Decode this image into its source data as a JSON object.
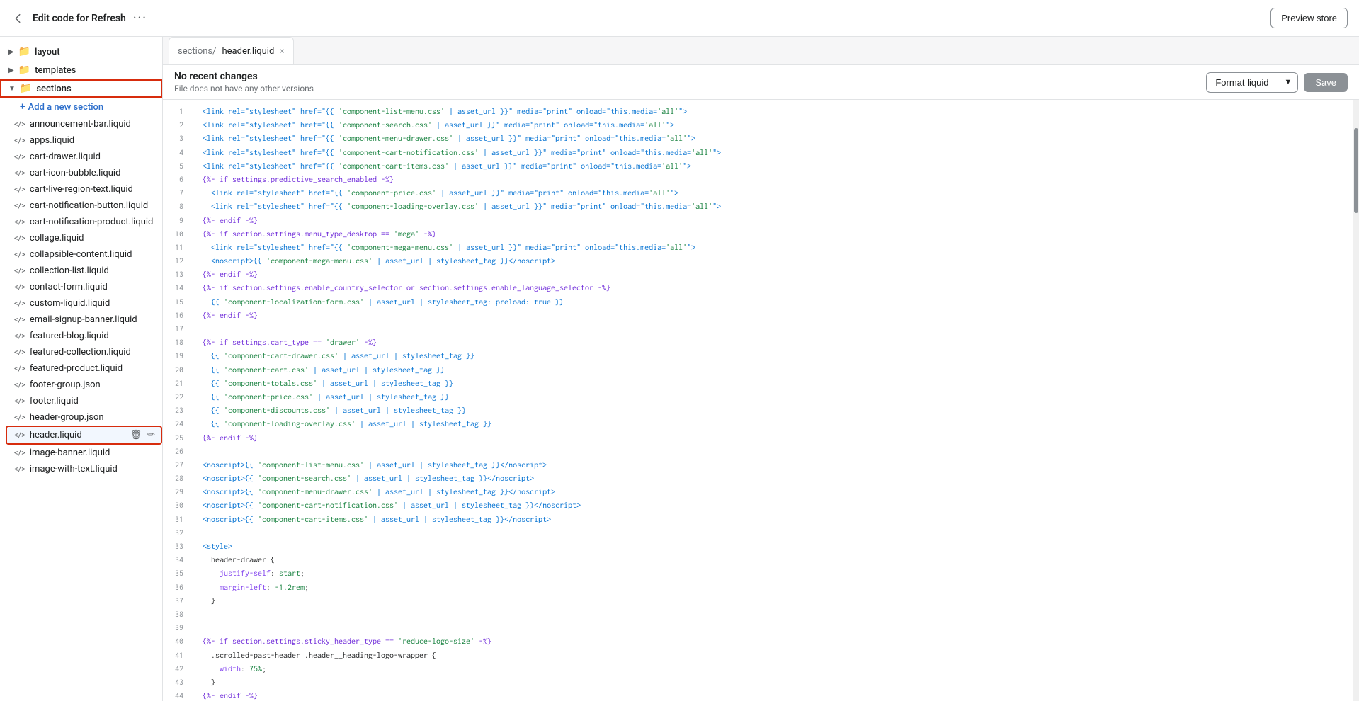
{
  "topbar": {
    "title": "Edit code for Refresh",
    "more_icon": "···",
    "preview_label": "Preview store",
    "back_icon": "←"
  },
  "sidebar": {
    "layout_label": "layout",
    "templates_label": "templates",
    "sections_label": "sections",
    "add_section_label": "Add a new section",
    "sections_files": [
      "announcement-bar.liquid",
      "apps.liquid",
      "cart-drawer.liquid",
      "cart-icon-bubble.liquid",
      "cart-live-region-text.liquid",
      "cart-notification-button.liquid",
      "cart-notification-product.liquid",
      "collage.liquid",
      "collapsible-content.liquid",
      "collection-list.liquid",
      "contact-form.liquid",
      "custom-liquid.liquid",
      "email-signup-banner.liquid",
      "featured-blog.liquid",
      "featured-collection.liquid",
      "featured-product.liquid",
      "footer-group.json",
      "footer.liquid",
      "header-group.json",
      "header.liquid",
      "image-banner.liquid",
      "image-with-text.liquid"
    ],
    "active_file": "header.liquid"
  },
  "tab": {
    "path": "sections/",
    "filename": "header.liquid",
    "close_icon": "×"
  },
  "status": {
    "title": "No recent changes",
    "subtitle": "File does not have any other versions"
  },
  "toolbar": {
    "format_label": "Format liquid",
    "save_label": "Save"
  },
  "code": {
    "lines": [
      {
        "num": 1,
        "content": "<link rel=\"stylesheet\" href=\"{{ 'component-list-menu.css' | asset_url }}\" media=\"print\" onload=\"this.media='all'\">"
      },
      {
        "num": 2,
        "content": "<link rel=\"stylesheet\" href=\"{{ 'component-search.css' | asset_url }}\" media=\"print\" onload=\"this.media='all'\">"
      },
      {
        "num": 3,
        "content": "<link rel=\"stylesheet\" href=\"{{ 'component-menu-drawer.css' | asset_url }}\" media=\"print\" onload=\"this.media='all'\">"
      },
      {
        "num": 4,
        "content": "<link rel=\"stylesheet\" href=\"{{ 'component-cart-notification.css' | asset_url }}\" media=\"print\" onload=\"this.media='all'\">"
      },
      {
        "num": 5,
        "content": "<link rel=\"stylesheet\" href=\"{{ 'component-cart-items.css' | asset_url }}\" media=\"print\" onload=\"this.media='all'\">"
      },
      {
        "num": 6,
        "content": "{%- if settings.predictive_search_enabled -%}"
      },
      {
        "num": 7,
        "content": "  <link rel=\"stylesheet\" href=\"{{ 'component-price.css' | asset_url }}\" media=\"print\" onload=\"this.media='all'\">"
      },
      {
        "num": 8,
        "content": "  <link rel=\"stylesheet\" href=\"{{ 'component-loading-overlay.css' | asset_url }}\" media=\"print\" onload=\"this.media='all'\">"
      },
      {
        "num": 9,
        "content": "{%- endif -%}"
      },
      {
        "num": 10,
        "content": "{%- if section.settings.menu_type_desktop == 'mega' -%}"
      },
      {
        "num": 11,
        "content": "  <link rel=\"stylesheet\" href=\"{{ 'component-mega-menu.css' | asset_url }}\" media=\"print\" onload=\"this.media='all'\">"
      },
      {
        "num": 12,
        "content": "  <noscript>{{ 'component-mega-menu.css' | asset_url | stylesheet_tag }}</noscript>"
      },
      {
        "num": 13,
        "content": "{%- endif -%}"
      },
      {
        "num": 14,
        "content": "{%- if section.settings.enable_country_selector or section.settings.enable_language_selector -%}"
      },
      {
        "num": 15,
        "content": "  {{ 'component-localization-form.css' | asset_url | stylesheet_tag: preload: true }}"
      },
      {
        "num": 16,
        "content": "{%- endif -%}"
      },
      {
        "num": 17,
        "content": ""
      },
      {
        "num": 18,
        "content": "{%- if settings.cart_type == 'drawer' -%}"
      },
      {
        "num": 19,
        "content": "  {{ 'component-cart-drawer.css' | asset_url | stylesheet_tag }}"
      },
      {
        "num": 20,
        "content": "  {{ 'component-cart.css' | asset_url | stylesheet_tag }}"
      },
      {
        "num": 21,
        "content": "  {{ 'component-totals.css' | asset_url | stylesheet_tag }}"
      },
      {
        "num": 22,
        "content": "  {{ 'component-price.css' | asset_url | stylesheet_tag }}"
      },
      {
        "num": 23,
        "content": "  {{ 'component-discounts.css' | asset_url | stylesheet_tag }}"
      },
      {
        "num": 24,
        "content": "  {{ 'component-loading-overlay.css' | asset_url | stylesheet_tag }}"
      },
      {
        "num": 25,
        "content": "{%- endif -%}"
      },
      {
        "num": 26,
        "content": ""
      },
      {
        "num": 27,
        "content": "<noscript>{{ 'component-list-menu.css' | asset_url | stylesheet_tag }}</noscript>"
      },
      {
        "num": 28,
        "content": "<noscript>{{ 'component-search.css' | asset_url | stylesheet_tag }}</noscript>"
      },
      {
        "num": 29,
        "content": "<noscript>{{ 'component-menu-drawer.css' | asset_url | stylesheet_tag }}</noscript>"
      },
      {
        "num": 30,
        "content": "<noscript>{{ 'component-cart-notification.css' | asset_url | stylesheet_tag }}</noscript>"
      },
      {
        "num": 31,
        "content": "<noscript>{{ 'component-cart-items.css' | asset_url | stylesheet_tag }}</noscript>"
      },
      {
        "num": 32,
        "content": ""
      },
      {
        "num": 33,
        "content": "<style>"
      },
      {
        "num": 34,
        "content": "  header-drawer {"
      },
      {
        "num": 35,
        "content": "    justify-self: start;"
      },
      {
        "num": 36,
        "content": "    margin-left: -1.2rem;"
      },
      {
        "num": 37,
        "content": "  }"
      },
      {
        "num": 38,
        "content": ""
      },
      {
        "num": 39,
        "content": ""
      },
      {
        "num": 40,
        "content": "{%- if section.settings.sticky_header_type == 'reduce-logo-size' -%}"
      },
      {
        "num": 41,
        "content": "  .scrolled-past-header .header__heading-logo-wrapper {"
      },
      {
        "num": 42,
        "content": "    width: 75%;"
      },
      {
        "num": 43,
        "content": "  }"
      },
      {
        "num": 44,
        "content": "{%- endif -%}"
      }
    ]
  }
}
